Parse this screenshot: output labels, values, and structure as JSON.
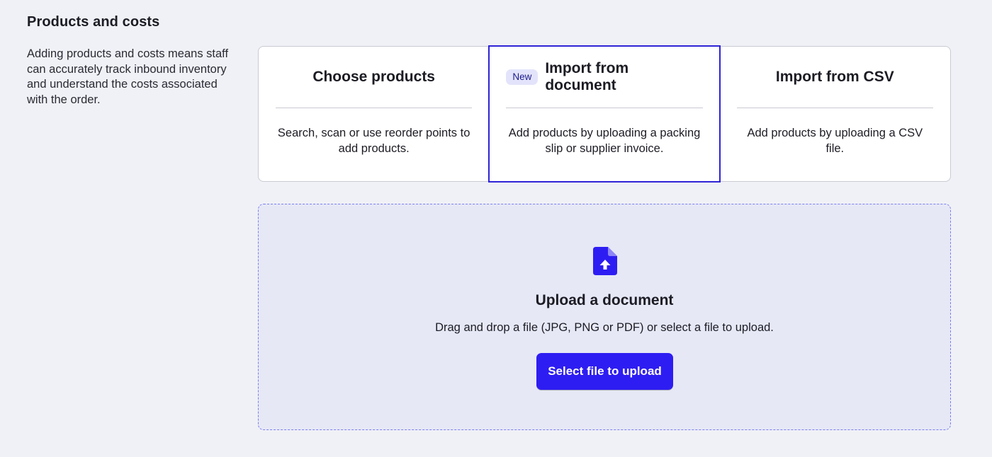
{
  "section": {
    "title": "Products and costs",
    "description": "Adding products and costs means staff can accurately track inbound inventory and understand the costs associated with the order."
  },
  "options": [
    {
      "title": "Choose products",
      "description": "Search, scan or use reorder points to add products.",
      "selected": false
    },
    {
      "badge": "New",
      "title": "Import from document",
      "description": "Add products by uploading a packing slip or supplier invoice.",
      "selected": true
    },
    {
      "title": "Import from CSV",
      "description": "Add products by uploading a CSV file.",
      "selected": false
    }
  ],
  "dropzone": {
    "icon": "file-upload-icon",
    "title": "Upload a document",
    "description": "Drag and drop a file (JPG, PNG or PDF) or select a file to upload.",
    "button_label": "Select file to upload"
  },
  "colors": {
    "accent": "#2e1df2",
    "selected_border": "#2f23d6",
    "badge_bg": "#e3e4fb",
    "dropzone_bg": "#e6e8f6",
    "page_bg": "#f0f1f6"
  }
}
